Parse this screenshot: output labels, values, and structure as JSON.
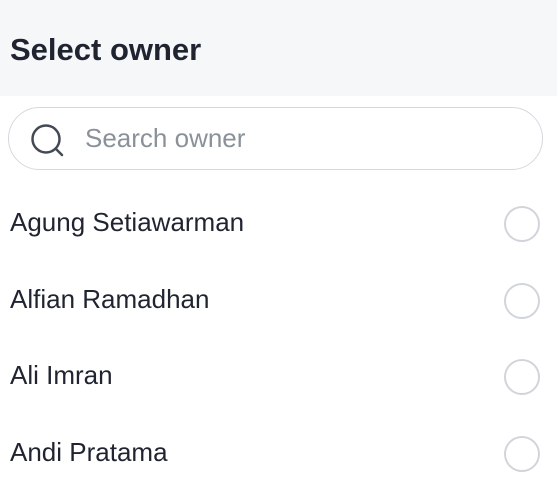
{
  "header": {
    "title": "Select owner"
  },
  "search": {
    "placeholder": "Search owner",
    "value": "",
    "icon": "search-icon"
  },
  "owners": [
    {
      "name": "Agung Setiawarman",
      "selected": false
    },
    {
      "name": "Alfian Ramadhan",
      "selected": false
    },
    {
      "name": "Ali Imran",
      "selected": false
    },
    {
      "name": "Andi Pratama",
      "selected": false
    }
  ],
  "colors": {
    "header_bg": "#f6f7f9",
    "text": "#1f2430",
    "placeholder": "#8b919b",
    "border": "#d5d9de"
  }
}
